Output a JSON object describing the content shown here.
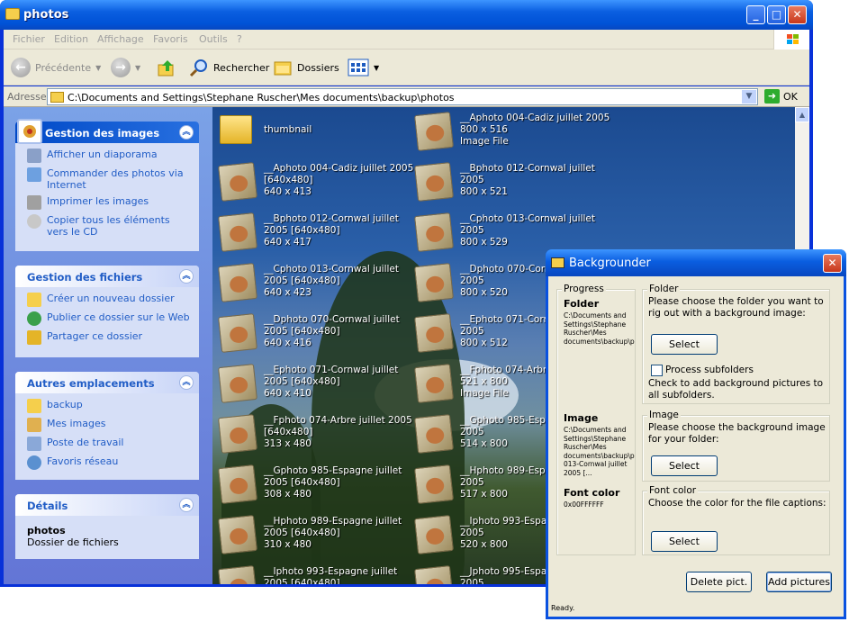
{
  "window": {
    "title": "photos"
  },
  "menu": [
    "Fichier",
    "Edition",
    "Affichage",
    "Favoris",
    "Outils",
    "?"
  ],
  "toolbar": {
    "back": "Précédente",
    "search": "Rechercher",
    "folders": "Dossiers"
  },
  "address": {
    "label": "Adresse",
    "value": "C:\\Documents and Settings\\Stephane Ruscher\\Mes documents\\backup\\photos",
    "go": "OK"
  },
  "tasks": {
    "images": {
      "title": "Gestion des images",
      "items": [
        "Afficher un diaporama",
        "Commander des photos via Internet",
        "Imprimer les images",
        "Copier tous les éléments vers le CD"
      ]
    },
    "files": {
      "title": "Gestion des fichiers",
      "items": [
        "Créer un nouveau dossier",
        "Publier ce dossier sur le Web",
        "Partager ce dossier"
      ]
    },
    "places": {
      "title": "Autres emplacements",
      "items": [
        "backup",
        "Mes images",
        "Poste de travail",
        "Favoris réseau"
      ]
    },
    "details": {
      "title": "Détails",
      "name": "photos",
      "type": "Dossier de fichiers"
    }
  },
  "files": [
    {
      "caption": "thumbnail",
      "kind": "folder"
    },
    {
      "caption": "__Aphoto 004-Cadiz juillet 2005\n800 x 516\nImage File"
    },
    {
      "caption": "__Aphoto 004-Cadiz juillet 2005\n[640x480]\n640 x 413"
    },
    {
      "caption": "__Bphoto 012-Cornwal juillet\n2005\n800 x 521"
    },
    {
      "caption": "__Bphoto 012-Cornwal juillet\n2005 [640x480]\n640 x 417"
    },
    {
      "caption": "__Cphoto 013-Cornwal juillet\n2005\n800 x 529"
    },
    {
      "caption": "__Cphoto 013-Cornwal juillet\n2005 [640x480]\n640 x 423"
    },
    {
      "caption": "__Dphoto 070-Corn\n2005\n800 x 520"
    },
    {
      "caption": "__Dphoto 070-Cornwal juillet\n2005 [640x480]\n640 x 416"
    },
    {
      "caption": "__Ephoto 071-Corn\n2005\n800 x 512"
    },
    {
      "caption": "__Ephoto 071-Cornwal juillet\n2005 [640x480]\n640 x 410"
    },
    {
      "caption": "__Fphoto 074-Arbre\n521 x 800\nImage File"
    },
    {
      "caption": "__Fphoto 074-Arbre juillet 2005\n[640x480]\n313 x 480"
    },
    {
      "caption": "__Gphoto 985-Espa\n2005\n514 x 800"
    },
    {
      "caption": "__Gphoto 985-Espagne juillet\n2005 [640x480]\n308 x 480"
    },
    {
      "caption": "__Hphoto 989-Espa\n2005\n517 x 800"
    },
    {
      "caption": "__Hphoto 989-Espagne juillet\n2005 [640x480]\n310 x 480"
    },
    {
      "caption": "__Iphoto 993-Espa\n2005\n520 x 800"
    },
    {
      "caption": "__Iphoto 993-Espagne juillet\n2005 [640x480]"
    },
    {
      "caption": "__Jphoto 995-Espa\n2005"
    }
  ],
  "dialog": {
    "title": "Backgrounder",
    "progress": {
      "legend": "Progress",
      "folder_label": "Folder",
      "folder_path": "C:\\Documents and Settings\\Stephane Ruscher\\Mes documents\\backup\\p",
      "image_label": "Image",
      "image_path": "C:\\Documents and Settings\\Stephane Ruscher\\Mes documents\\backup\\p 013-Cornwal juillet 2005 [...",
      "color_label": "Font color",
      "color_value": "0x00FFFFFF"
    },
    "folder": {
      "legend": "Folder",
      "text": "Please choose the folder you want to rig out with a background image:",
      "button": "Select",
      "checkbox": "Process subfolders",
      "check_text": "Check to add background pictures to all subfolders."
    },
    "image": {
      "legend": "Image",
      "text": "Please choose the background image for your folder:",
      "button": "Select"
    },
    "fontcolor": {
      "legend": "Font color",
      "text": "Choose the color for the file captions:",
      "button": "Select"
    },
    "delete": "Delete pict.",
    "add": "Add pictures",
    "status": "Ready."
  }
}
